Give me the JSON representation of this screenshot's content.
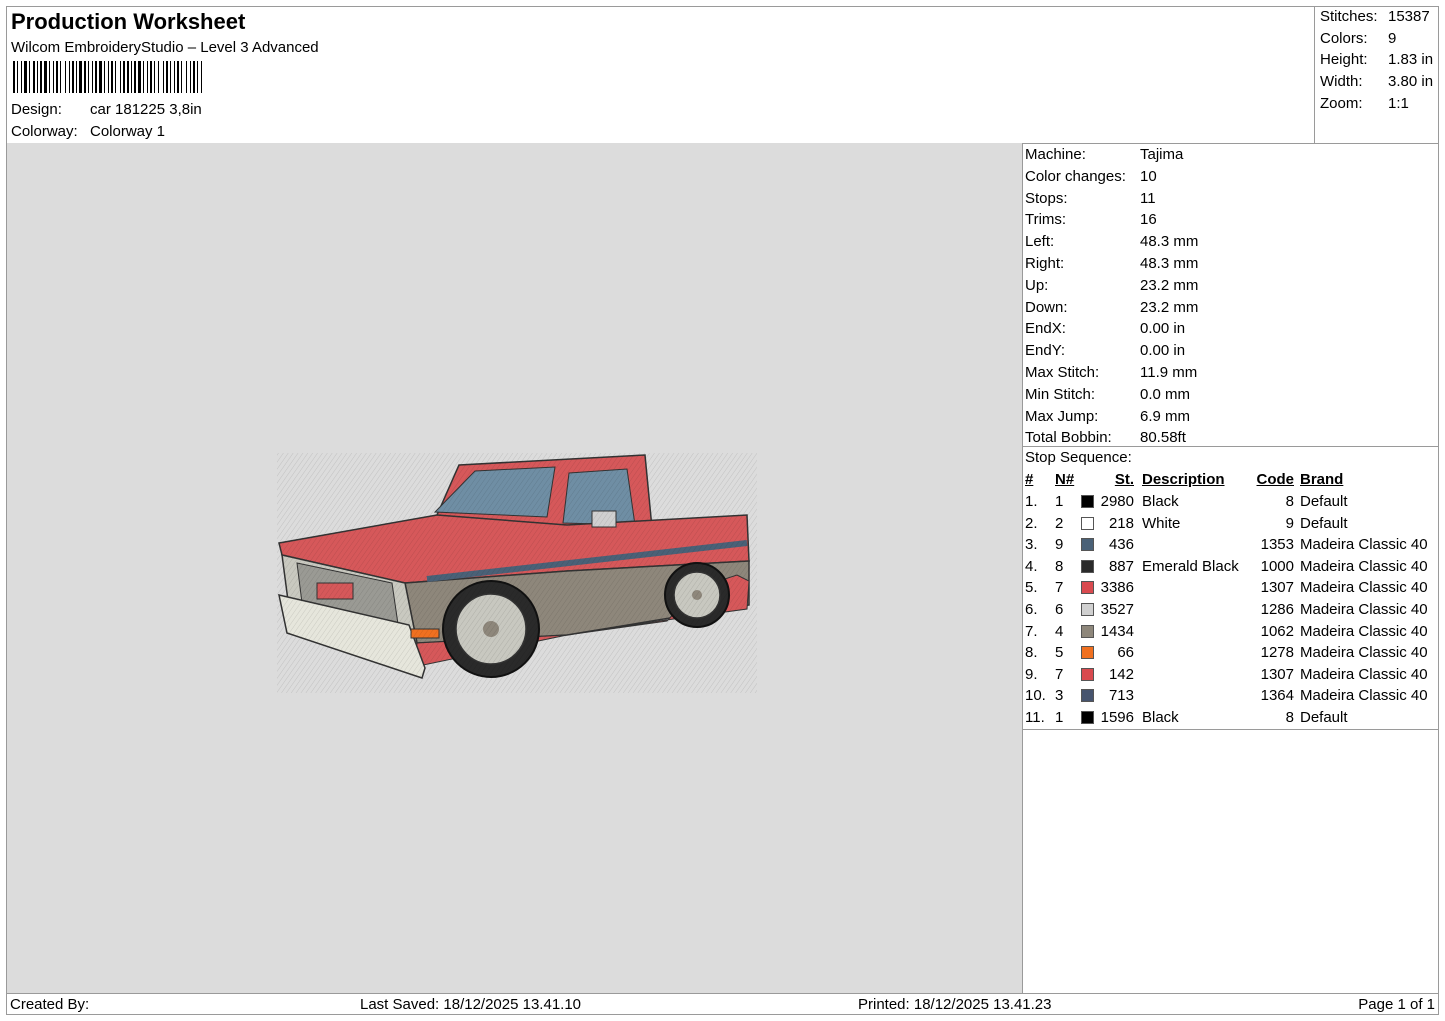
{
  "header": {
    "title": "Production Worksheet",
    "subtitle": "Wilcom EmbroideryStudio – Level 3 Advanced",
    "design_label": "Design:",
    "design_value": "car 181225 3,8in",
    "colorway_label": "Colorway:",
    "colorway_value": "Colorway 1"
  },
  "stats": [
    {
      "label": "Stitches:",
      "value": "15387"
    },
    {
      "label": "Colors:",
      "value": "9"
    },
    {
      "label": "Height:",
      "value": "1.83 in"
    },
    {
      "label": "Width:",
      "value": "3.80 in"
    },
    {
      "label": "Zoom:",
      "value": "1:1"
    }
  ],
  "machine_info": [
    {
      "label": "Machine:",
      "value": "Tajima"
    },
    {
      "label": "Color changes:",
      "value": "10"
    },
    {
      "label": "Stops:",
      "value": "11"
    },
    {
      "label": "Trims:",
      "value": "16"
    },
    {
      "label": "Left:",
      "value": "48.3 mm"
    },
    {
      "label": "Right:",
      "value": "48.3 mm"
    },
    {
      "label": "Up:",
      "value": "23.2 mm"
    },
    {
      "label": "Down:",
      "value": "23.2 mm"
    },
    {
      "label": "EndX:",
      "value": "0.00 in"
    },
    {
      "label": "EndY:",
      "value": "0.00 in"
    },
    {
      "label": "Max Stitch:",
      "value": "11.9 mm"
    },
    {
      "label": "Min Stitch:",
      "value": "0.0 mm"
    },
    {
      "label": "Max Jump:",
      "value": "6.9 mm"
    },
    {
      "label": "Total Bobbin:",
      "value": "80.58ft"
    }
  ],
  "stop_sequence": {
    "title": "Stop Sequence:",
    "headers": [
      "#",
      "N#",
      "St.",
      "Description",
      "Code",
      "Brand"
    ],
    "rows": [
      {
        "idx": "1.",
        "n": "1",
        "color": "#000000",
        "st": "2980",
        "desc": "Black",
        "code": "8",
        "brand": "Default"
      },
      {
        "idx": "2.",
        "n": "2",
        "color": "#ffffff",
        "st": "218",
        "desc": "White",
        "code": "9",
        "brand": "Default"
      },
      {
        "idx": "3.",
        "n": "9",
        "color": "#4a6177",
        "st": "436",
        "desc": "",
        "code": "1353",
        "brand": "Madeira Classic 40"
      },
      {
        "idx": "4.",
        "n": "8",
        "color": "#2a2a2a",
        "st": "887",
        "desc": "Emerald Black",
        "code": "1000",
        "brand": "Madeira Classic 40"
      },
      {
        "idx": "5.",
        "n": "7",
        "color": "#d94a4f",
        "st": "3386",
        "desc": "",
        "code": "1307",
        "brand": "Madeira Classic 40"
      },
      {
        "idx": "6.",
        "n": "6",
        "color": "#d0d0d0",
        "st": "3527",
        "desc": "",
        "code": "1286",
        "brand": "Madeira Classic 40"
      },
      {
        "idx": "7.",
        "n": "4",
        "color": "#8e877b",
        "st": "1434",
        "desc": "",
        "code": "1062",
        "brand": "Madeira Classic 40"
      },
      {
        "idx": "8.",
        "n": "5",
        "color": "#f07020",
        "st": "66",
        "desc": "",
        "code": "1278",
        "brand": "Madeira Classic 40"
      },
      {
        "idx": "9.",
        "n": "7",
        "color": "#d94a4f",
        "st": "142",
        "desc": "",
        "code": "1307",
        "brand": "Madeira Classic 40"
      },
      {
        "idx": "10.",
        "n": "3",
        "color": "#46546e",
        "st": "713",
        "desc": "",
        "code": "1364",
        "brand": "Madeira Classic 40"
      },
      {
        "idx": "11.",
        "n": "1",
        "color": "#000000",
        "st": "1596",
        "desc": "Black",
        "code": "8",
        "brand": "Default"
      }
    ]
  },
  "footer": {
    "created_by": "Created By:",
    "last_saved": "Last Saved: 18/12/2025 13.41.10",
    "printed": "Printed: 18/12/2025 13.41.23",
    "page": "Page 1 of 1"
  }
}
